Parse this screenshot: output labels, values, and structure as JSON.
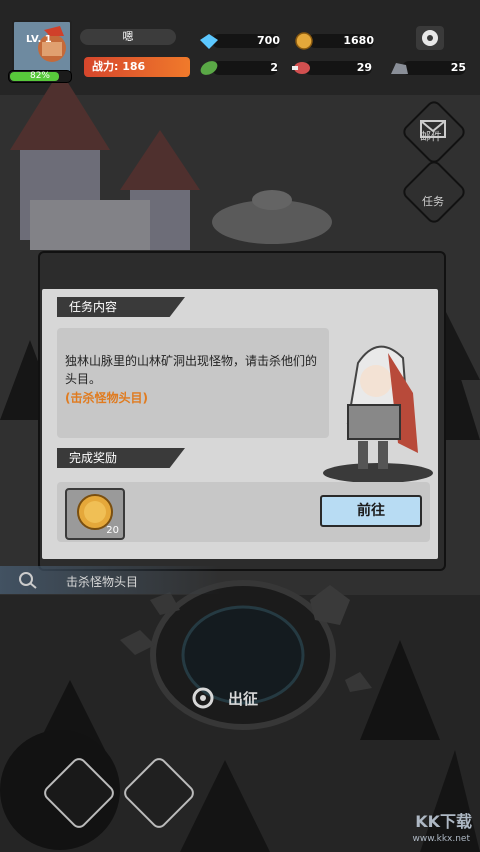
{
  "hud": {
    "level": "LV. 1",
    "exp_percent": "82%",
    "player_name": "嗯",
    "power_label": "战力: 186",
    "diamonds": "700",
    "gold": "1680",
    "leaf": "2",
    "meat": "29",
    "ore": "25"
  },
  "side": {
    "mail_label": "邮件",
    "task_label": "任务"
  },
  "dialog": {
    "task_header": "任务内容",
    "task_text": "独林山脉里的山林矿洞出现怪物，请击杀他们的头目。",
    "task_hint": "(击杀怪物头目)",
    "reward_header": "完成奖励",
    "reward_count": "20",
    "go_button": "前往"
  },
  "scene": {
    "quest_tracker": "击杀怪物头目",
    "portal_label": "出征"
  },
  "watermark": {
    "text": "KK下载",
    "url": "www.kkx.net"
  },
  "colors": {
    "power_bar": "#e25a2c",
    "exp_bar": "#58c93b",
    "go_button": "#b8dcf3",
    "hint_text": "#e07b1f"
  }
}
